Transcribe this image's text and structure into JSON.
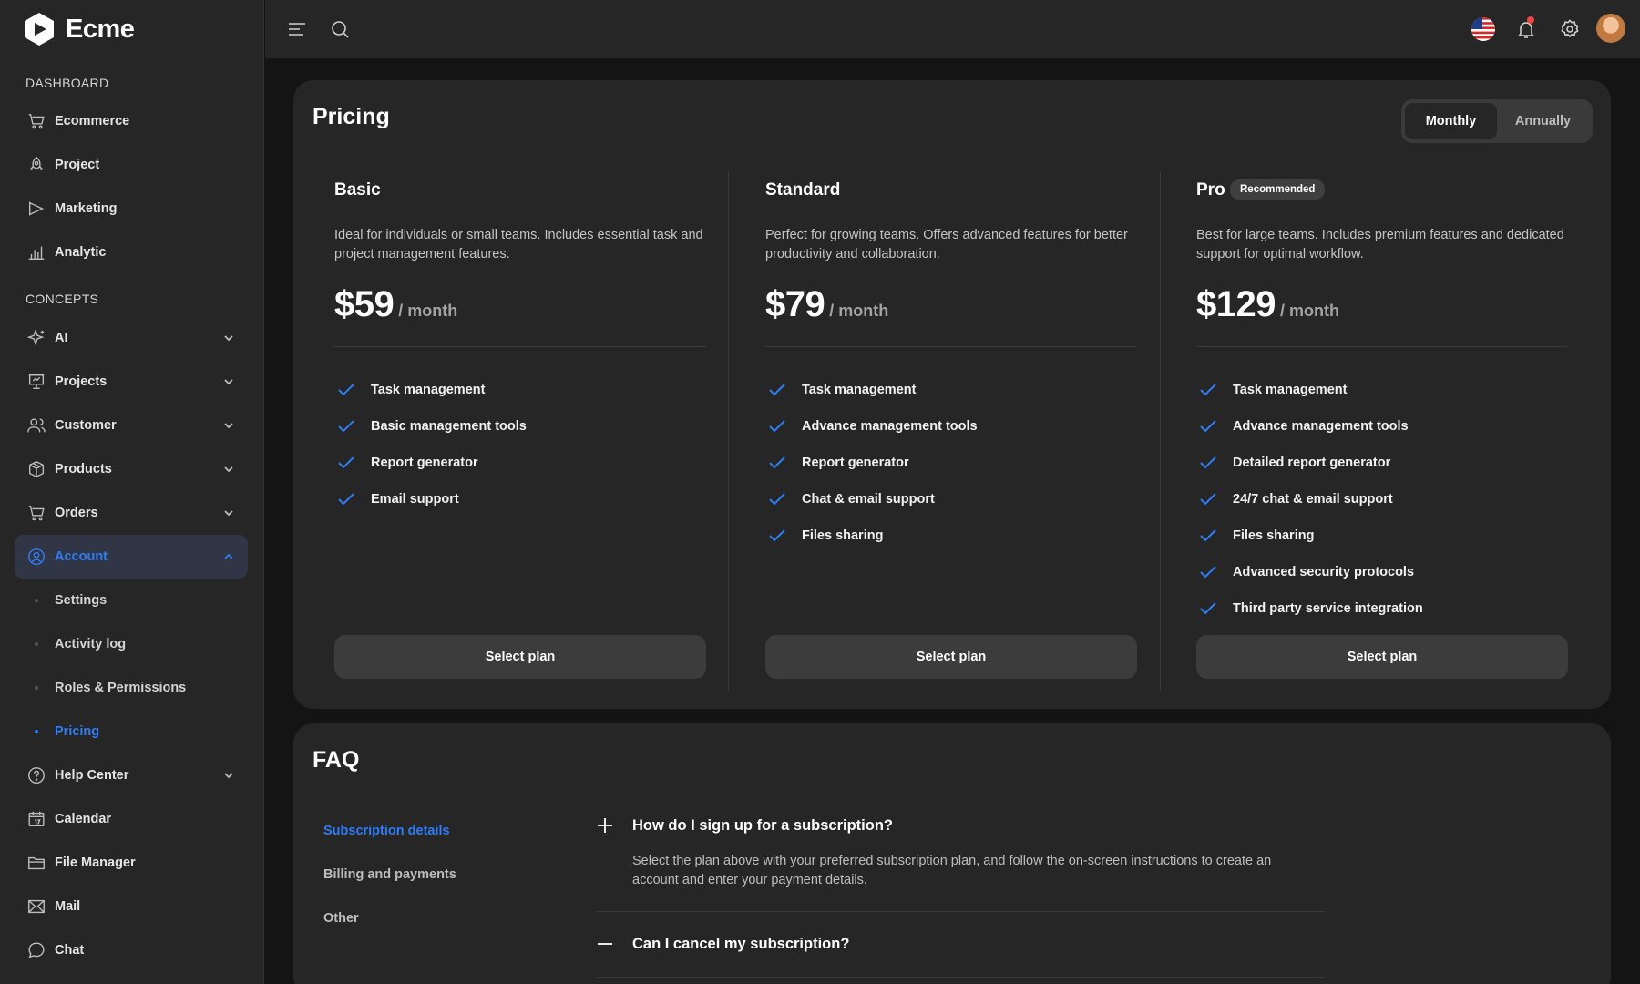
{
  "brand": {
    "name": "Ecme"
  },
  "sidebar": {
    "sections": [
      {
        "title": "DASHBOARD"
      },
      {
        "title": "CONCEPTS"
      }
    ],
    "dashboard_items": [
      {
        "label": "Ecommerce",
        "icon": "cart-icon"
      },
      {
        "label": "Project",
        "icon": "rocket-icon"
      },
      {
        "label": "Marketing",
        "icon": "megaphone-icon"
      },
      {
        "label": "Analytic",
        "icon": "bar-chart-icon"
      }
    ],
    "concept_items": [
      {
        "label": "AI",
        "icon": "sparkle-icon",
        "expandable": true
      },
      {
        "label": "Projects",
        "icon": "presentation-icon",
        "expandable": true
      },
      {
        "label": "Customer",
        "icon": "users-icon",
        "expandable": true
      },
      {
        "label": "Products",
        "icon": "box-icon",
        "expandable": true
      },
      {
        "label": "Orders",
        "icon": "cart-icon",
        "expandable": true
      },
      {
        "label": "Account",
        "icon": "user-circle-icon",
        "expandable": true,
        "active": true
      }
    ],
    "account_sub_items": [
      {
        "label": "Settings"
      },
      {
        "label": "Activity log"
      },
      {
        "label": "Roles & Permissions"
      },
      {
        "label": "Pricing",
        "active": true
      }
    ],
    "bottom_items": [
      {
        "label": "Help Center",
        "icon": "help-circle-icon",
        "expandable": true
      },
      {
        "label": "Calendar",
        "icon": "calendar-icon"
      },
      {
        "label": "File Manager",
        "icon": "folder-icon"
      },
      {
        "label": "Mail",
        "icon": "mail-icon"
      },
      {
        "label": "Chat",
        "icon": "chat-icon"
      }
    ]
  },
  "header": {
    "icons": [
      "menu-icon",
      "search-icon",
      "us-flag-icon",
      "bell-icon",
      "gear-icon",
      "avatar"
    ]
  },
  "pricing": {
    "title": "Pricing",
    "billing_toggle": {
      "options": [
        "Monthly",
        "Annually"
      ],
      "selected": "Monthly"
    },
    "plans": [
      {
        "name": "Basic",
        "badge": "",
        "description": "Ideal for individuals or small teams. Includes essential task and project management features.",
        "price": "$59",
        "unit": "/ month",
        "features": [
          "Task management",
          "Basic management tools",
          "Report generator",
          "Email support"
        ],
        "button": "Select plan"
      },
      {
        "name": "Standard",
        "badge": "",
        "description": "Perfect for growing teams. Offers advanced features for better productivity and collaboration.",
        "price": "$79",
        "unit": "/ month",
        "features": [
          "Task management",
          "Advance management tools",
          "Report generator",
          "Chat & email support",
          "Files sharing"
        ],
        "button": "Select plan"
      },
      {
        "name": "Pro",
        "badge": "Recommended",
        "description": "Best for large teams. Includes premium features and dedicated support for optimal workflow.",
        "price": "$129",
        "unit": "/ month",
        "features": [
          "Task management",
          "Advance management tools",
          "Detailed report generator",
          "24/7 chat & email support",
          "Files sharing",
          "Advanced security protocols",
          "Third party service integration"
        ],
        "button": "Select plan"
      }
    ]
  },
  "faq": {
    "title": "FAQ",
    "categories": [
      {
        "label": "Subscription details",
        "active": true
      },
      {
        "label": "Billing and payments"
      },
      {
        "label": "Other"
      }
    ],
    "questions": [
      {
        "question": "How do I sign up for a subscription?",
        "answer": "Select the plan above with your preferred subscription plan, and follow the on-screen instructions to create an account and enter your payment details.",
        "expanded": true
      },
      {
        "question": "Can I cancel my subscription?",
        "answer": "",
        "expanded": false
      }
    ]
  },
  "colors": {
    "accent": "#2f7df6",
    "background": "#141414",
    "surface": "#262626"
  }
}
